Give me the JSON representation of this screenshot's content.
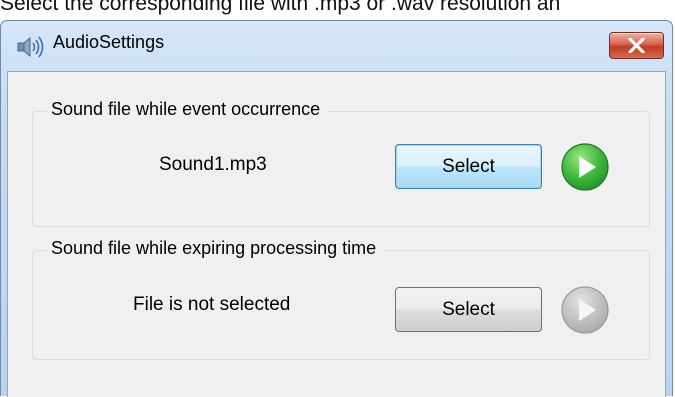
{
  "caption": "Select the corresponding file with .mp3 or .wav resolution an",
  "window": {
    "title": "AudioSettings",
    "title_icon": "speaker-icon",
    "close_icon": "close-icon"
  },
  "groups": [
    {
      "legend": "Sound file while event occurrence",
      "file_label": "Sound1.mp3",
      "select_label": "Select",
      "play_icon": "play-icon",
      "play_enabled": true
    },
    {
      "legend": "Sound file while expiring processing time",
      "file_label": "File is not selected",
      "select_label": "Select",
      "play_icon": "play-icon",
      "play_enabled": false
    }
  ],
  "colors": {
    "play_enabled": "#3cb83c",
    "play_disabled": "#b8b8b8",
    "close_button": "#c8402a",
    "title_bar": "#c6daf1"
  }
}
